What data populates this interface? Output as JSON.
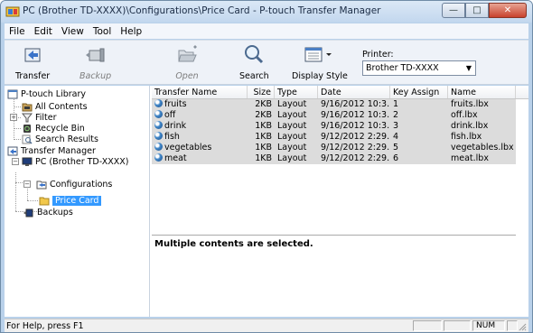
{
  "window": {
    "title": "PC (Brother TD-XXXX)\\Configurations\\Price Card - P-touch Transfer Manager",
    "min_glyph": "—",
    "max_glyph": "□",
    "close_glyph": "✕"
  },
  "menu": [
    "File",
    "Edit",
    "View",
    "Tool",
    "Help"
  ],
  "toolbar": {
    "transfer": "Transfer",
    "backup": "Backup",
    "open": "Open",
    "search": "Search",
    "display_style": "Display Style",
    "printer_label": "Printer:",
    "printer_value": "Brother TD-XXXX",
    "dropdown_arrow": "▼"
  },
  "tree": {
    "library": "P-touch Library",
    "all_contents": "All Contents",
    "filter": "Filter",
    "recycle_bin": "Recycle Bin",
    "search_results": "Search Results",
    "transfer_manager": "Transfer Manager",
    "pc": "PC (Brother TD-XXXX)",
    "configurations": "Configurations",
    "price_card": "Price Card",
    "backups": "Backups",
    "expand_plus": "+",
    "expand_minus": "−"
  },
  "list": {
    "headers": [
      "Transfer Name",
      "Size",
      "Type",
      "Date",
      "Key Assign",
      "Name"
    ],
    "rows": [
      [
        "fruits",
        "2KB",
        "Layout",
        "9/16/2012 10:3...",
        "1",
        "fruits.lbx"
      ],
      [
        "off",
        "2KB",
        "Layout",
        "9/16/2012 10:3...",
        "2",
        "off.lbx"
      ],
      [
        "drink",
        "1KB",
        "Layout",
        "9/16/2012 10:3...",
        "3",
        "drink.lbx"
      ],
      [
        "fish",
        "1KB",
        "Layout",
        "9/12/2012 2:29...",
        "4",
        "fish.lbx"
      ],
      [
        "vegetables",
        "1KB",
        "Layout",
        "9/12/2012 2:29...",
        "5",
        "vegetables.lbx"
      ],
      [
        "meat",
        "1KB",
        "Layout",
        "9/12/2012 2:29...",
        "6",
        "meat.lbx"
      ]
    ]
  },
  "preview": {
    "message": "Multiple contents are selected."
  },
  "status": {
    "help": "For Help, press F1",
    "num": "NUM"
  }
}
